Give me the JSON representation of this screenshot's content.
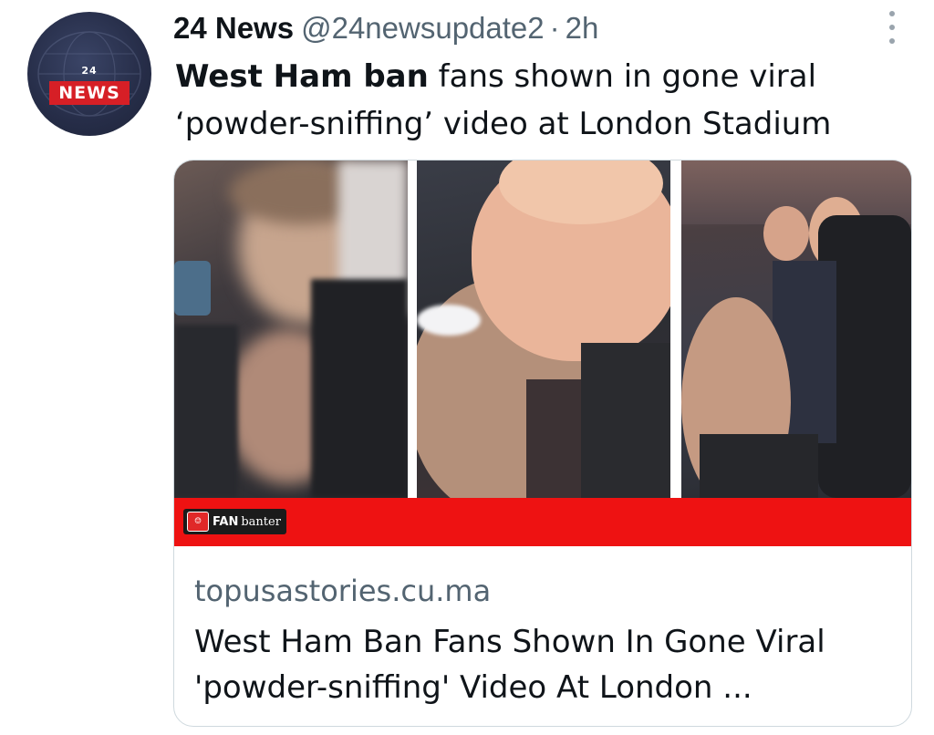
{
  "account": {
    "avatar_number": "24",
    "avatar_label": "NEWS",
    "display_name": "24 News",
    "handle": "@24newsupdate2",
    "separator": "·",
    "time": "2h"
  },
  "tweet": {
    "text_bold": "West Ham ban",
    "text_rest": " fans shown in gone viral ‘powder-sniffing’ video at London Stadium"
  },
  "card": {
    "badge_fan": "FAN",
    "badge_banter": "banter",
    "domain": "topusastories.cu.ma",
    "title": "West Ham Ban Fans Shown In Gone Viral 'powder-sniffing' Video At London ..."
  },
  "icons": {
    "more": "more-vertical-icon",
    "badge_logo": "fan-banter-logo-icon"
  },
  "colors": {
    "red_bar": "#ee1212",
    "avatar_red": "#d61f26",
    "secondary_text": "#536471"
  }
}
